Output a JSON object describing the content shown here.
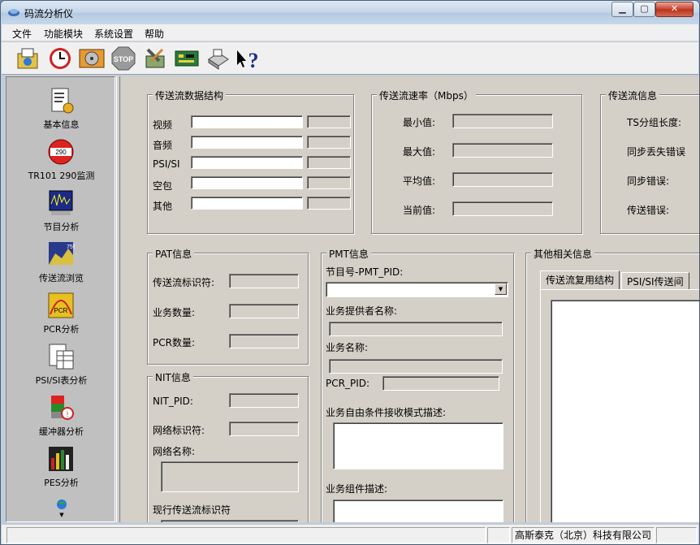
{
  "window": {
    "title": "码流分析仪",
    "minimize": "0",
    "maximize": "1",
    "close": "r"
  },
  "menu": [
    "文件",
    "功能模块",
    "系统设置",
    "帮助"
  ],
  "toolbar": [
    "open-icon",
    "clock-icon",
    "disk-icon",
    "stop-icon",
    "tools-icon",
    "chip-icon",
    "printer-icon",
    "help-icon"
  ],
  "nav": [
    {
      "label": "基本信息",
      "icon": "document-icon"
    },
    {
      "label": "TR101 290监测",
      "icon": "tr101-290-icon"
    },
    {
      "label": "节目分析",
      "icon": "waveform-icon"
    },
    {
      "label": "传送流浏览",
      "icon": "ts-browse-icon"
    },
    {
      "label": "PCR分析",
      "icon": "pcr-icon"
    },
    {
      "label": "PSI/SI表分析",
      "icon": "table-icon"
    },
    {
      "label": "缓冲器分析",
      "icon": "buffer-icon"
    },
    {
      "label": "PES分析",
      "icon": "pes-icon"
    }
  ],
  "ts_structure": {
    "title": "传送流数据结构",
    "rows": [
      "视频",
      "音频",
      "PSI/SI",
      "空包",
      "其他"
    ]
  },
  "ts_rate": {
    "title": "传送流速率（Mbps）",
    "rows": [
      "最小值:",
      "最大值:",
      "平均值:",
      "当前值:"
    ]
  },
  "ts_info": {
    "title": "传送流信息",
    "rows": [
      "TS分组长度:",
      "同步丢失错误",
      "同步错误:",
      "传送错误:"
    ]
  },
  "pat": {
    "title": "PAT信息",
    "rows": [
      "传送流标识符:",
      "业务数量:",
      "PCR数量:"
    ]
  },
  "nit": {
    "title": "NIT信息",
    "nit_pid": "NIT_PID:",
    "network_id": "网络标识符:",
    "network_name": "网络名称:",
    "current_ts_id": "现行传送流标识符"
  },
  "pmt": {
    "title": "PMT信息",
    "program_pid": "节目号-PMT_PID:",
    "provider_name": "业务提供者名称:",
    "service_name": "业务名称:",
    "pcr_pid": "PCR_PID:",
    "ca_desc": "业务自由条件接收模式描述:",
    "component_desc": "业务组件描述:"
  },
  "other": {
    "title": "其他相关信息",
    "tabs": [
      "传送流复用结构",
      "PSI/SI传送间"
    ]
  },
  "status": {
    "company": "高斯泰克（北京）科技有限公司"
  }
}
